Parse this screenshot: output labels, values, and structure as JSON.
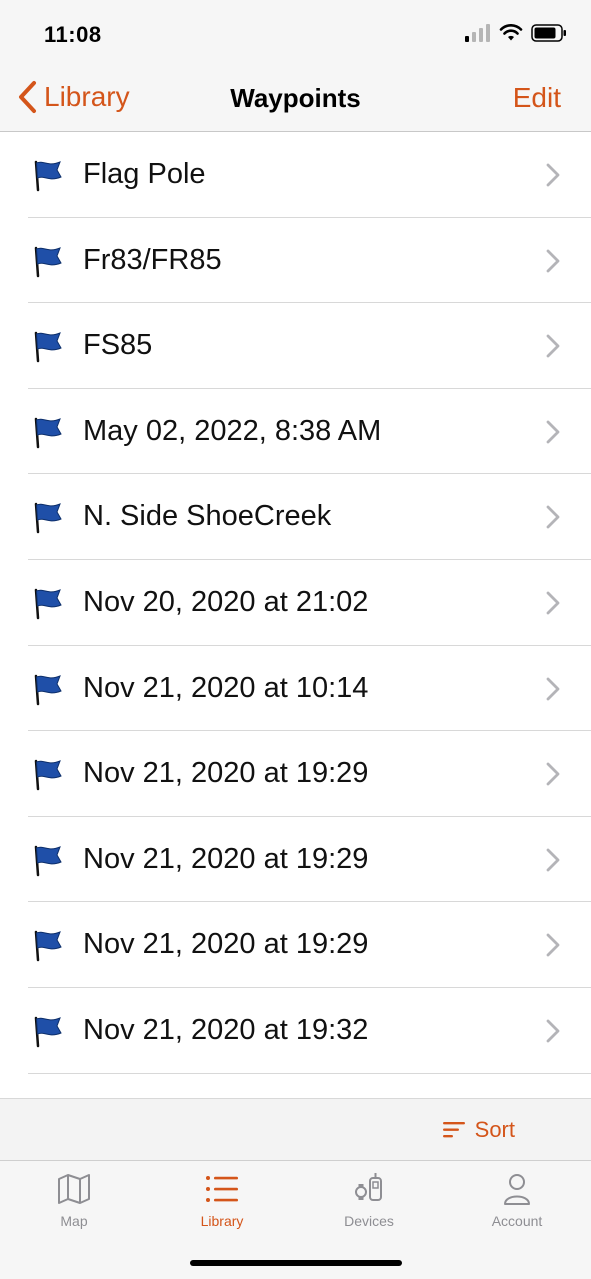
{
  "status_bar": {
    "time": "11:08",
    "icons": [
      "signal-icon",
      "wifi-icon",
      "battery-icon"
    ]
  },
  "nav": {
    "back_label": "Library",
    "title": "Waypoints",
    "edit_label": "Edit"
  },
  "waypoints": [
    {
      "label": "Flag Pole"
    },
    {
      "label": "Fr83/FR85"
    },
    {
      "label": "FS85"
    },
    {
      "label": "May 02, 2022, 8:38 AM"
    },
    {
      "label": "N. Side ShoeCreek"
    },
    {
      "label": "Nov 20, 2020 at 21:02"
    },
    {
      "label": "Nov 21, 2020 at 10:14"
    },
    {
      "label": "Nov 21, 2020 at 19:29"
    },
    {
      "label": "Nov 21, 2020 at 19:29"
    },
    {
      "label": "Nov 21, 2020 at 19:29"
    },
    {
      "label": "Nov 21, 2020 at 19:32"
    }
  ],
  "sort": {
    "label": "Sort",
    "icon": "sort-icon"
  },
  "tabs": [
    {
      "label": "Map",
      "icon": "map-icon",
      "active": false
    },
    {
      "label": "Library",
      "icon": "list-icon",
      "active": true
    },
    {
      "label": "Devices",
      "icon": "devices-icon",
      "active": false
    },
    {
      "label": "Account",
      "icon": "person-icon",
      "active": false
    }
  ],
  "colors": {
    "accent": "#d4551a",
    "flag": "#1f4fa8",
    "inactive_tab": "#8e8e93"
  }
}
